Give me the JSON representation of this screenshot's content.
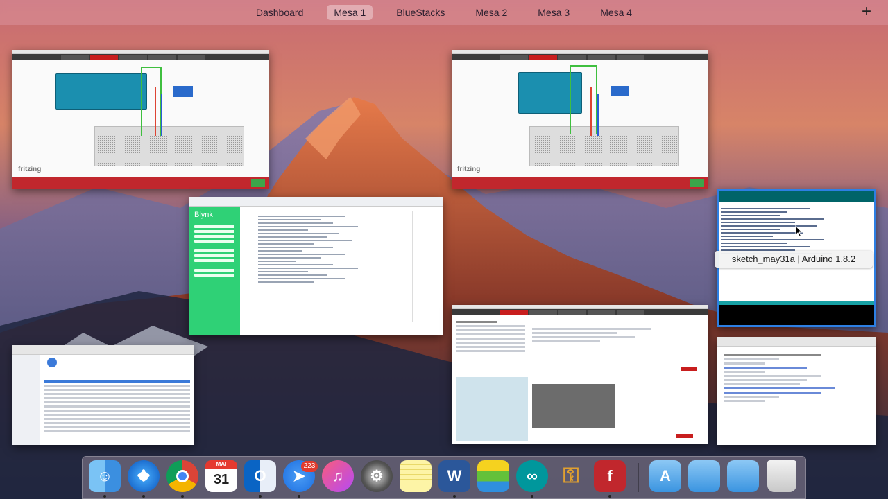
{
  "spaces": {
    "items": [
      {
        "label": "Dashboard",
        "active": false
      },
      {
        "label": "Mesa 1",
        "active": true
      },
      {
        "label": "BlueStacks",
        "active": false
      },
      {
        "label": "Mesa 2",
        "active": false
      },
      {
        "label": "Mesa 3",
        "active": false
      },
      {
        "label": "Mesa 4",
        "active": false
      }
    ],
    "add_label": "+"
  },
  "windows": {
    "fritzing_1": {
      "logo": "fritzing"
    },
    "fritzing_2": {
      "logo": "fritzing"
    },
    "blynk": {
      "logo": "Blynk"
    },
    "arduino_ide": {
      "title": "sketch_may31a | Arduino 1.8.2"
    }
  },
  "dock": {
    "calendar_month": "MAI",
    "calendar_day": "31",
    "mail_badge": "223",
    "apps": [
      "finder-icon",
      "safari-icon",
      "chrome-icon",
      "calendar-icon",
      "outlook-icon",
      "spark-icon",
      "itunes-icon",
      "system-preferences-icon",
      "notes-icon",
      "word-icon",
      "bluestacks-icon",
      "arduino-icon",
      "keychain-icon",
      "fritzing-icon",
      "applications-folder-icon",
      "documents-folder-icon",
      "downloads-folder-icon",
      "trash-icon"
    ]
  },
  "colors": {
    "accent": "#2d7fe3",
    "fritzing_red": "#c1272d",
    "blynk_green": "#2fd176",
    "arduino_teal": "#006468"
  }
}
